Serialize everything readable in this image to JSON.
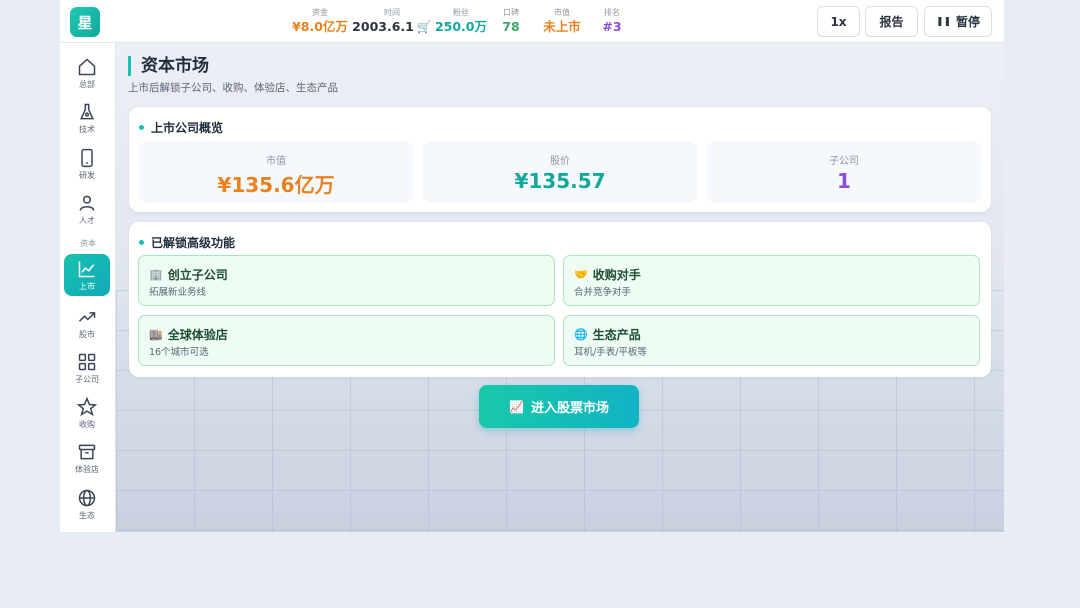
{
  "header": {
    "logo_text": "星",
    "stats": [
      {
        "label": "资金",
        "value": "¥8.0亿万",
        "color": "#e8821e"
      },
      {
        "label": "时间",
        "value": "2003.6.1",
        "color": "#2a3442"
      },
      {
        "label": "粉丝",
        "value": "250.0万",
        "color": "#13a89e"
      },
      {
        "label": "口碑",
        "value": "78",
        "color": "#3aa86b"
      },
      {
        "label": "市值",
        "value": "未上市",
        "color": "#e8821e"
      },
      {
        "label": "排名",
        "value": "#3",
        "color": "#8a4fd6"
      }
    ],
    "cart_icon": "shopping-cart-icon",
    "speed_label": "1x",
    "report_label": "报告",
    "pause_label": "暂停"
  },
  "sidebar": {
    "section_label": "资本",
    "items": [
      {
        "label": "总部",
        "icon": "home-icon"
      },
      {
        "label": "技术",
        "icon": "flask-icon"
      },
      {
        "label": "研发",
        "icon": "phone-icon"
      },
      {
        "label": "人才",
        "icon": "person-icon"
      },
      {
        "label": "上市",
        "icon": "chart-line-icon",
        "active": true
      },
      {
        "label": "股市",
        "icon": "trending-up-icon"
      },
      {
        "label": "子公司",
        "icon": "grid-icon"
      },
      {
        "label": "收购",
        "icon": "star-icon"
      },
      {
        "label": "体验店",
        "icon": "store-icon"
      },
      {
        "label": "生态",
        "icon": "globe-icon"
      }
    ]
  },
  "main": {
    "title": "资本市场",
    "subtitle": "上市后解锁子公司、收购、体验店、生态产品",
    "overview": {
      "title": "上市公司概览",
      "metrics": [
        {
          "label": "市值",
          "value": "¥135.6亿万",
          "color": "#e8821e"
        },
        {
          "label": "股价",
          "value": "¥135.57",
          "color": "#13a89e"
        },
        {
          "label": "子公司",
          "value": "1",
          "color": "#8a4fd6"
        }
      ]
    },
    "features": {
      "title": "已解锁高级功能",
      "items": [
        {
          "title": "创立子公司",
          "desc": "拓展新业务线",
          "icon": "building-icon"
        },
        {
          "title": "收购对手",
          "desc": "合并竞争对手",
          "icon": "handshake-icon"
        },
        {
          "title": "全球体验店",
          "desc": "16个城市可选",
          "icon": "office-icon"
        },
        {
          "title": "生态产品",
          "desc": "耳机/手表/平板等",
          "icon": "globe-icon"
        }
      ]
    },
    "enter_button": "进入股票市场"
  },
  "colors": {
    "accent": "#17c2b0",
    "feature_bg": "#effcf3",
    "feature_border": "#a8e6bd"
  }
}
